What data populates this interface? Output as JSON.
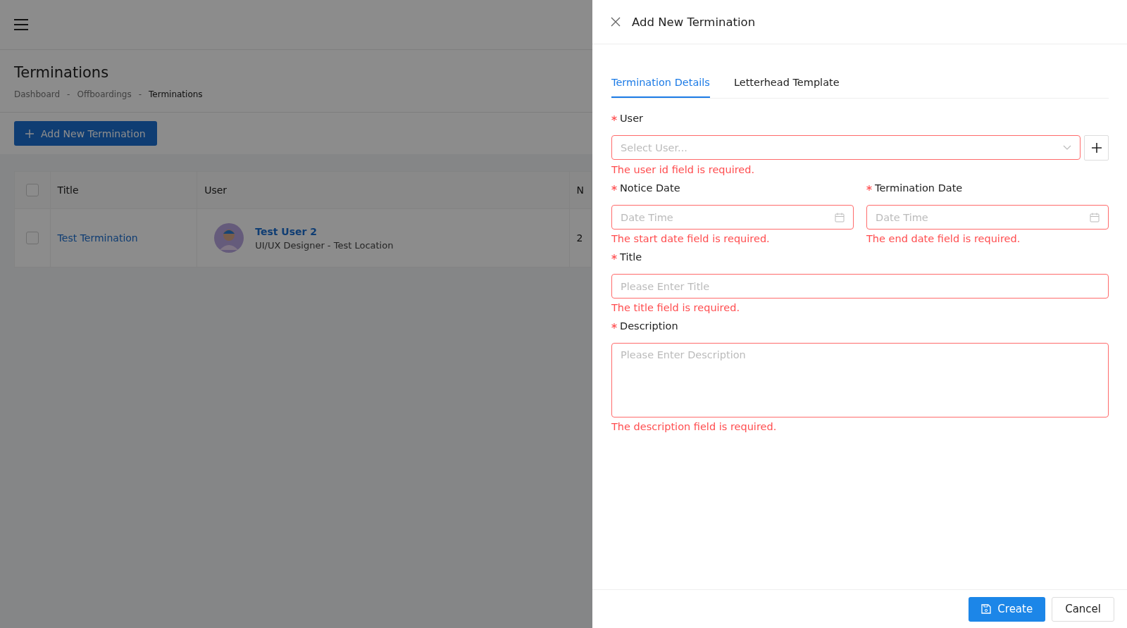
{
  "page": {
    "title": "Terminations",
    "breadcrumb": [
      {
        "label": "Dashboard",
        "current": false
      },
      {
        "label": "Offboardings",
        "current": false
      },
      {
        "label": "Terminations",
        "current": true
      }
    ],
    "separator": "-",
    "add_button": "Add New Termination"
  },
  "table": {
    "columns": [
      {
        "label": "Title"
      },
      {
        "label": "User"
      },
      {
        "label": "N"
      }
    ],
    "rows": [
      {
        "checked": false,
        "title": "Test Termination",
        "user_name": "Test User 2",
        "user_subtitle": "UI/UX Designer - Test Location",
        "column_3": "2"
      }
    ],
    "header_checked": false
  },
  "drawer": {
    "title": "Add New Termination",
    "tabs": [
      {
        "label": "Termination Details",
        "selected": true
      },
      {
        "label": "Letterhead Template",
        "selected": false
      }
    ],
    "fields": [
      {
        "kind": "select",
        "label": "User",
        "required": true,
        "placeholder": "Select User...",
        "error": "The user id field is required."
      },
      {
        "kind": "date",
        "label": "Notice Date",
        "required": true,
        "placeholder": "Date Time",
        "error": "The start date field is required."
      },
      {
        "kind": "date",
        "label": "Termination Date",
        "required": true,
        "placeholder": "Date Time",
        "error": "The end date field is required."
      },
      {
        "kind": "text",
        "label": "Title",
        "required": true,
        "placeholder": "Please Enter Title",
        "error": "The title field is required."
      },
      {
        "kind": "textarea",
        "label": "Description",
        "required": true,
        "placeholder": "Please Enter Description",
        "error": "The description field is required."
      }
    ],
    "buttons": [
      {
        "kind": "primary",
        "label": "Create"
      },
      {
        "kind": "default",
        "label": "Cancel"
      }
    ]
  }
}
